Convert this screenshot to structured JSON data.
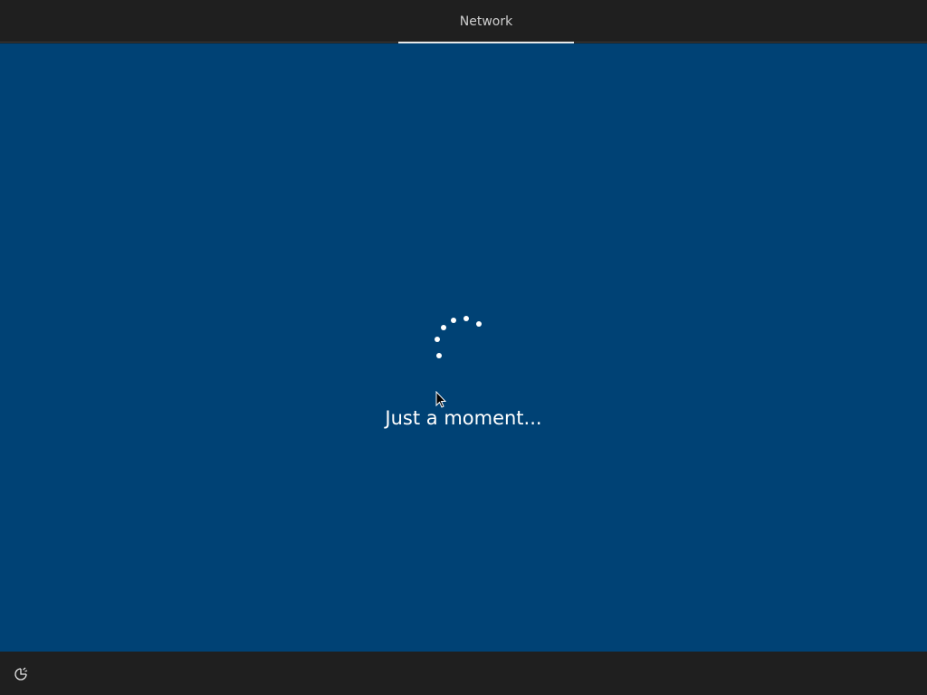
{
  "header": {
    "tabs": [
      {
        "label": "Network",
        "active": true
      }
    ]
  },
  "main": {
    "status_message": "Just a moment...",
    "background_color": "#004275",
    "spinner": {
      "state": "loading"
    }
  },
  "footer": {
    "accessibility_icon": "ease-of-access-icon"
  },
  "colors": {
    "bar_background": "#1f1f1f",
    "accent_text": "#ffffff"
  }
}
